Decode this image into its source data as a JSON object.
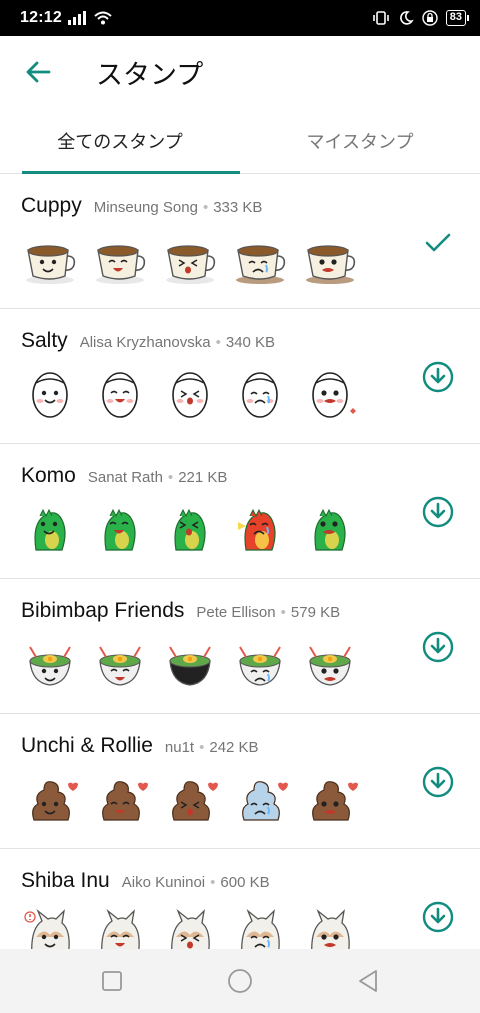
{
  "status": {
    "time": "12:12",
    "battery": "83"
  },
  "header": {
    "title": "スタンプ"
  },
  "tabs": [
    {
      "label": "全てのスタンプ",
      "active": true
    },
    {
      "label": "マイスタンプ",
      "active": false
    }
  ],
  "packs": [
    {
      "name": "Cuppy",
      "author": "Minseung Song",
      "size": "333 KB",
      "status": "installed",
      "theme": "cup",
      "colors": [
        "#f5f0e0",
        "#8b5a2b",
        "#c0c0c0"
      ]
    },
    {
      "name": "Salty",
      "author": "Alisa Kryzhanovska",
      "size": "340 KB",
      "status": "download",
      "theme": "face",
      "colors": [
        "#ffffff",
        "#222222",
        "#f8b4b4"
      ]
    },
    {
      "name": "Komo",
      "author": "Sanat Rath",
      "size": "221 KB",
      "status": "download",
      "theme": "dino",
      "colors": [
        "#2bb14a",
        "#e8412a",
        "#f7d94c"
      ]
    },
    {
      "name": "Bibimbap Friends",
      "author": "Pete Ellison",
      "size": "579 KB",
      "status": "download",
      "theme": "bowl",
      "colors": [
        "#f0f0f0",
        "#f2c94c",
        "#e2584c"
      ]
    },
    {
      "name": "Unchi & Rollie",
      "author": "nu1t",
      "size": "242 KB",
      "status": "download",
      "theme": "poop",
      "colors": [
        "#8a5a3b",
        "#b7d3ea",
        "#e2584c"
      ]
    },
    {
      "name": "Shiba Inu",
      "author": "Aiko Kuninoi",
      "size": "600 KB",
      "status": "download",
      "theme": "shiba",
      "colors": [
        "#f2f0ea",
        "#d08a4a",
        "#555555"
      ]
    }
  ],
  "icons": {
    "back": "arrow-back-icon",
    "installed": "check-icon",
    "download": "download-icon",
    "nav": [
      "square-icon",
      "circle-icon",
      "triangle-icon"
    ]
  },
  "colors": {
    "accent": "#128c7e",
    "divider": "#e3e3e3"
  }
}
